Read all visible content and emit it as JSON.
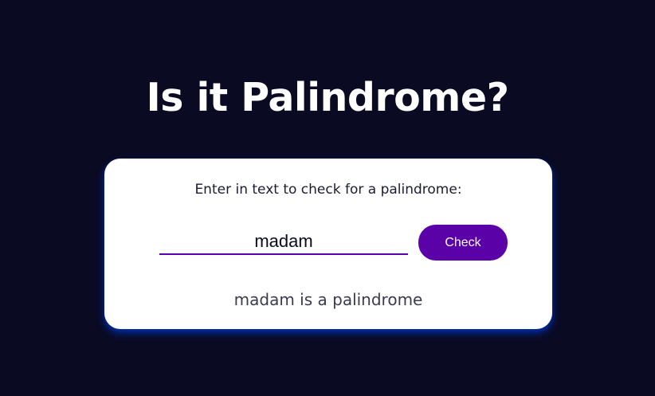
{
  "page": {
    "title": "Is it Palindrome?"
  },
  "checker": {
    "instructions": "Enter in text to check for a palindrome:",
    "input_value": "madam",
    "button_label": "Check",
    "result": "madam is a palindrome"
  },
  "colors": {
    "background": "#0a0a23",
    "card": "#ffffff",
    "accent": "#5a01a7",
    "card_glow": "#002ead"
  }
}
